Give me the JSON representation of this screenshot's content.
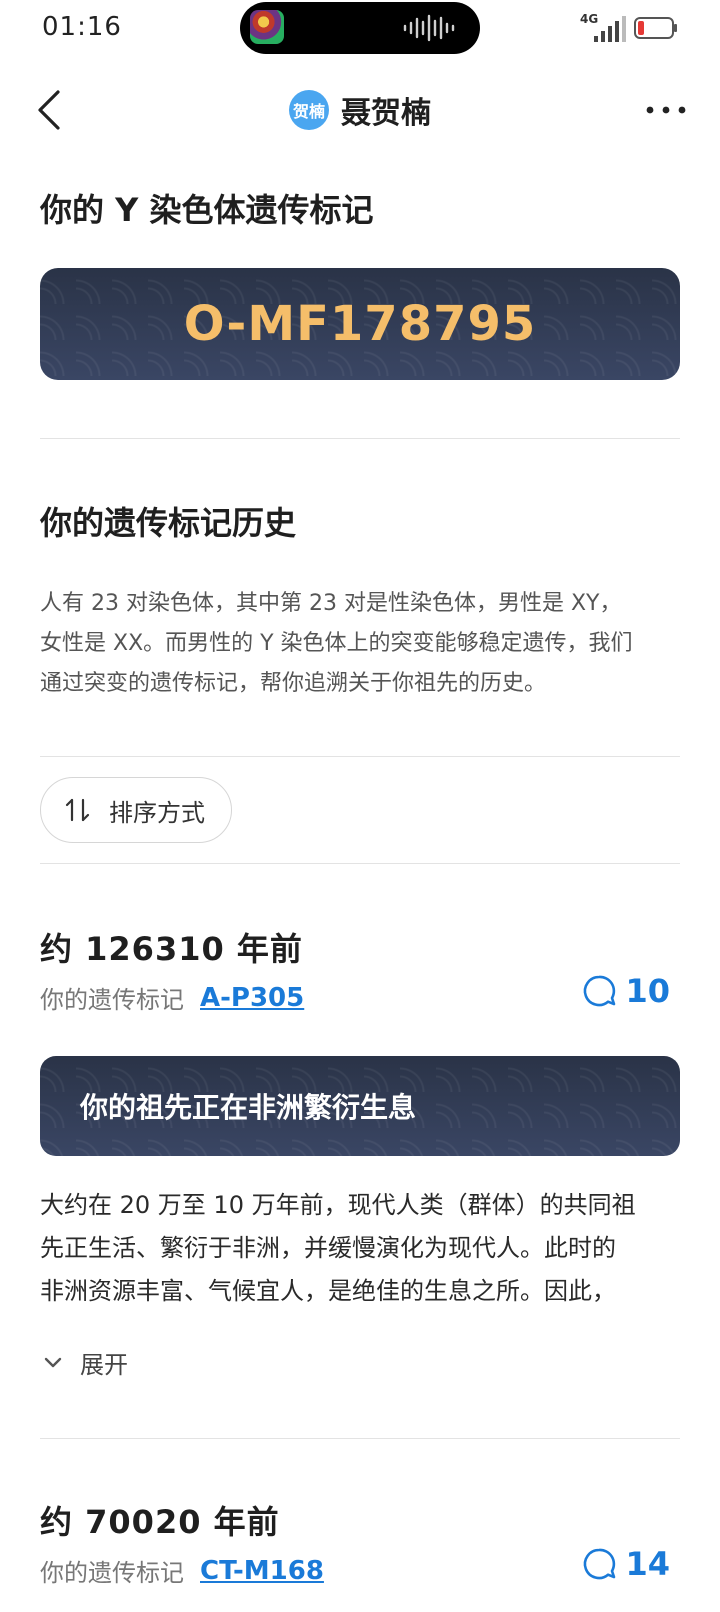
{
  "status_bar": {
    "time": "01:16",
    "network": "4G"
  },
  "nav": {
    "avatar_text": "贺楠",
    "title": "聂贺楠"
  },
  "marker_section": {
    "heading": "你的 Y 染色体遗传标记",
    "marker_code": "O-MF178795"
  },
  "history_section": {
    "heading": "你的遗传标记历史",
    "description_lines": [
      "人有 23 对染色体，其中第 23 对是性染色体，男性是 XY，",
      "女性是 XX。而男性的 Y 染色体上的突变能够稳定遗传，我们",
      "通过突变的遗传标记，帮你追溯关于你祖先的历史。"
    ],
    "sort_label": "排序方式"
  },
  "entries": [
    {
      "age": "约 126310 年前",
      "marker_prefix": "你的遗传标记",
      "marker_link": "A-P305",
      "comment_count": "10",
      "banner": "你的祖先正在非洲繁衍生息",
      "text_lines": [
        "大约在 20 万至 10 万年前，现代人类（群体）的共同祖",
        "先正生活、繁衍于非洲，并缓慢演化为现代人。此时的",
        "非洲资源丰富、气候宜人，是绝佳的生息之所。因此，"
      ],
      "expand_label": "展开"
    },
    {
      "age": "约 70020 年前",
      "marker_prefix": "你的遗传标记",
      "marker_link": "CT-M168",
      "comment_count": "14"
    }
  ],
  "colors": {
    "accent_blue": "#1a7ad8",
    "marker_gold": "#f5be6a",
    "banner_navy": "#2f3a55"
  }
}
